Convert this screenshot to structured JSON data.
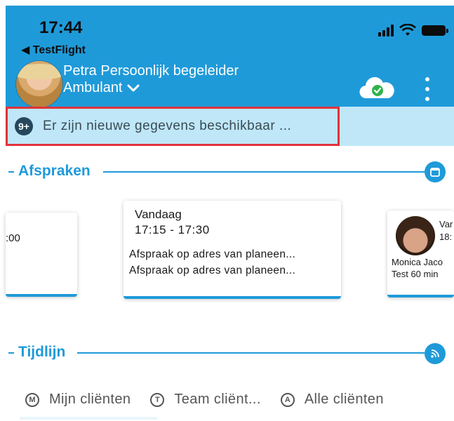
{
  "status_bar": {
    "time": "17:44",
    "back_label": "TestFlight"
  },
  "header": {
    "user_name": "Petra Persoonlijk begeleider",
    "role": "Ambulant",
    "colors": {
      "header_bg": "#1f9ad9",
      "sync_ok": "#2fb34a"
    },
    "icons": [
      "avatar",
      "chevron-down-icon",
      "cloud-sync-icon",
      "more-vertical-icon"
    ]
  },
  "notice": {
    "badge": "9+",
    "text": "Er zijn nieuwe gegevens beschikbaar ..."
  },
  "appointments": {
    "title": "Afspraken",
    "left_card": {
      "time_fragment": ":00"
    },
    "main_card": {
      "day": "Vandaag",
      "time": "17:15 - 17:30",
      "lines": [
        "Afspraak op adres van planeen...",
        "Afspraak op adres van planeen..."
      ]
    },
    "right_card": {
      "name_fragment": "Var",
      "time_fragment": "18:",
      "client_name": "Monica Jaco",
      "appointment": "Test 60 min"
    }
  },
  "timeline": {
    "title": "Tijdlijn",
    "filters": [
      {
        "letter": "M",
        "label": "Mijn cliënten"
      },
      {
        "letter": "T",
        "label": "Team cliënt..."
      },
      {
        "letter": "A",
        "label": "Alle cliënten"
      }
    ]
  }
}
